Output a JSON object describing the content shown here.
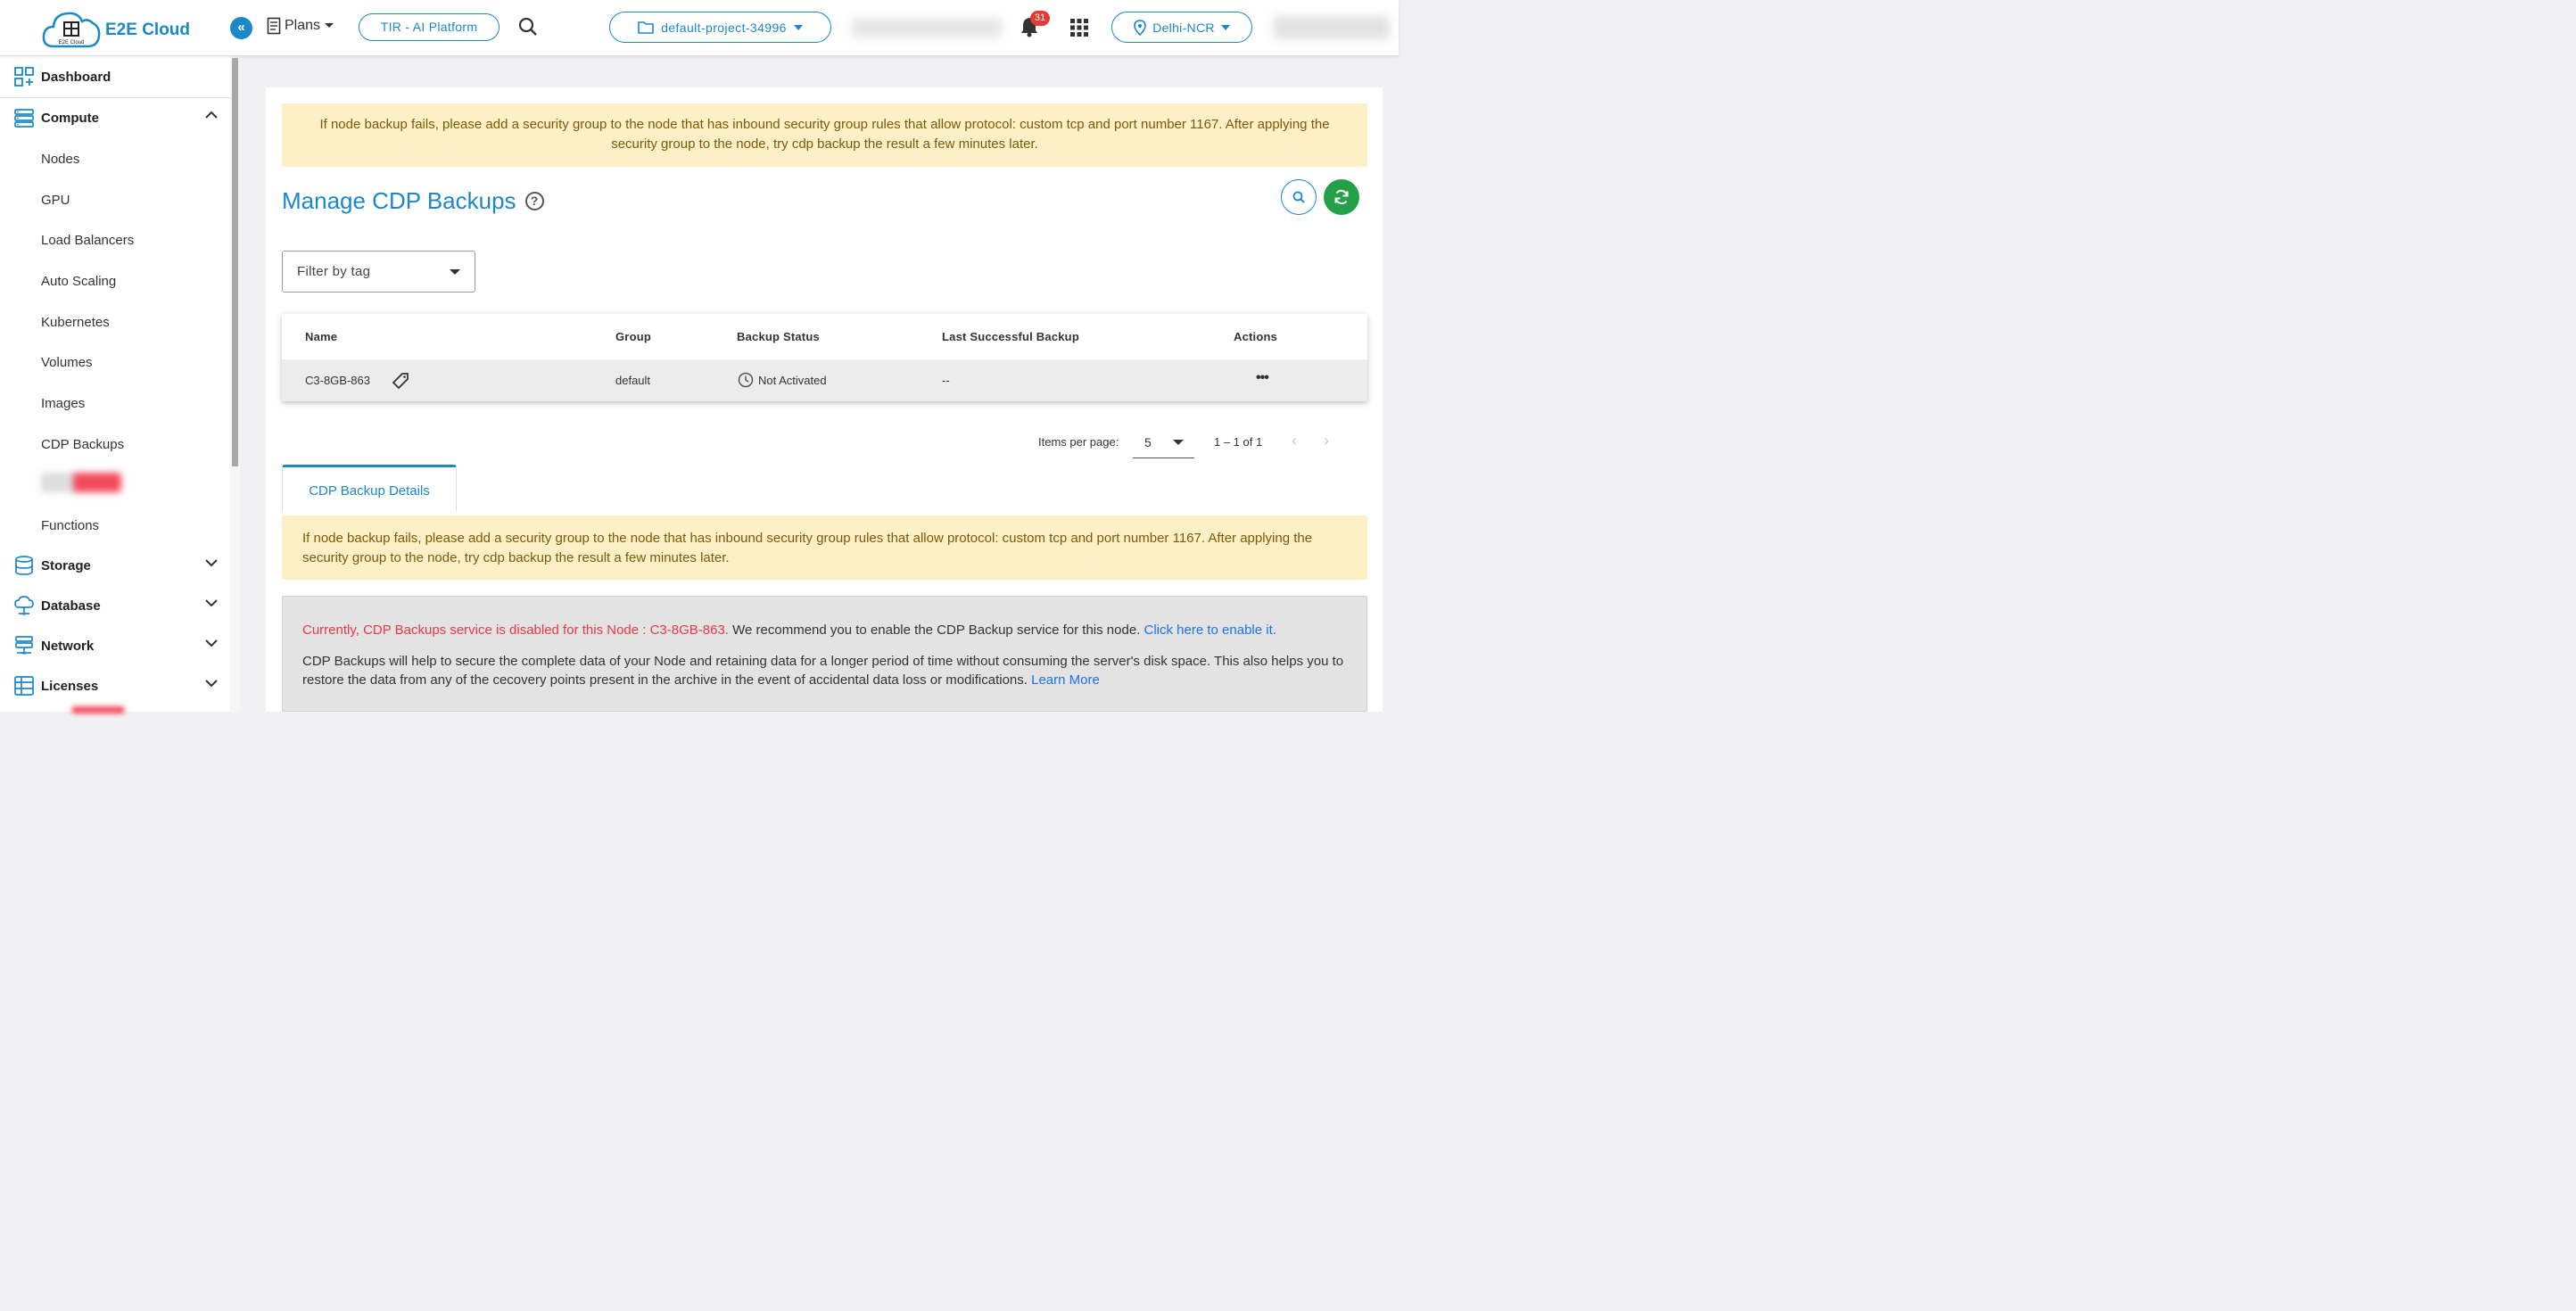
{
  "header": {
    "logo_text": "E2E Cloud",
    "logo_subtext": "E2E Cloud",
    "plans_label": "Plans",
    "tir_label": "TIR - AI Platform",
    "project_label": "default-project-34996",
    "notification_count": "31",
    "region_label": "Delhi-NCR"
  },
  "sidebar": {
    "dashboard": "Dashboard",
    "compute": "Compute",
    "compute_items": [
      "Nodes",
      "GPU",
      "Load Balancers",
      "Auto Scaling",
      "Kubernetes",
      "Volumes",
      "Images",
      "CDP Backups",
      "Functions"
    ],
    "storage": "Storage",
    "database": "Database",
    "network": "Network",
    "licenses": "Licenses"
  },
  "alert_text": "If node backup fails, please add a security group to the node that has inbound security group rules that allow protocol: custom tcp and port number 1167. After applying the security group to the node, try cdp backup the result a few minutes later.",
  "page_title": "Manage CDP Backups",
  "help_glyph": "?",
  "filter_placeholder": "Filter by tag",
  "table": {
    "headers": {
      "name": "Name",
      "group": "Group",
      "status": "Backup Status",
      "last": "Last Successful Backup",
      "actions": "Actions"
    },
    "rows": [
      {
        "name": "C3-8GB-863",
        "group": "default",
        "status": "Not Activated",
        "last": "--",
        "actions": "•••"
      }
    ]
  },
  "paginator": {
    "items_label": "Items per page:",
    "per_page": "5",
    "range": "1 – 1 of 1"
  },
  "tab_label": "CDP Backup Details",
  "details": {
    "disabled_text": "Currently, CDP Backups service is disabled for this Node : C3-8GB-863.",
    "recommend_text": " We recommend you to enable the CDP Backup service for this node. ",
    "enable_link": "Click here to enable it.",
    "description": "CDP Backups will help to secure the complete data of your Node and retaining data for a longer period of time without consuming the server's disk space. This also helps you to restore the data from any of the cecovery points present in the archive in the event of accidental data loss or modifications. ",
    "learn_more": "Learn More"
  },
  "colors": {
    "brand": "#1a88c9",
    "refresh": "#24a148",
    "alert_bg": "#fdf0c6",
    "error": "#e53946",
    "link": "#1a73e8"
  }
}
